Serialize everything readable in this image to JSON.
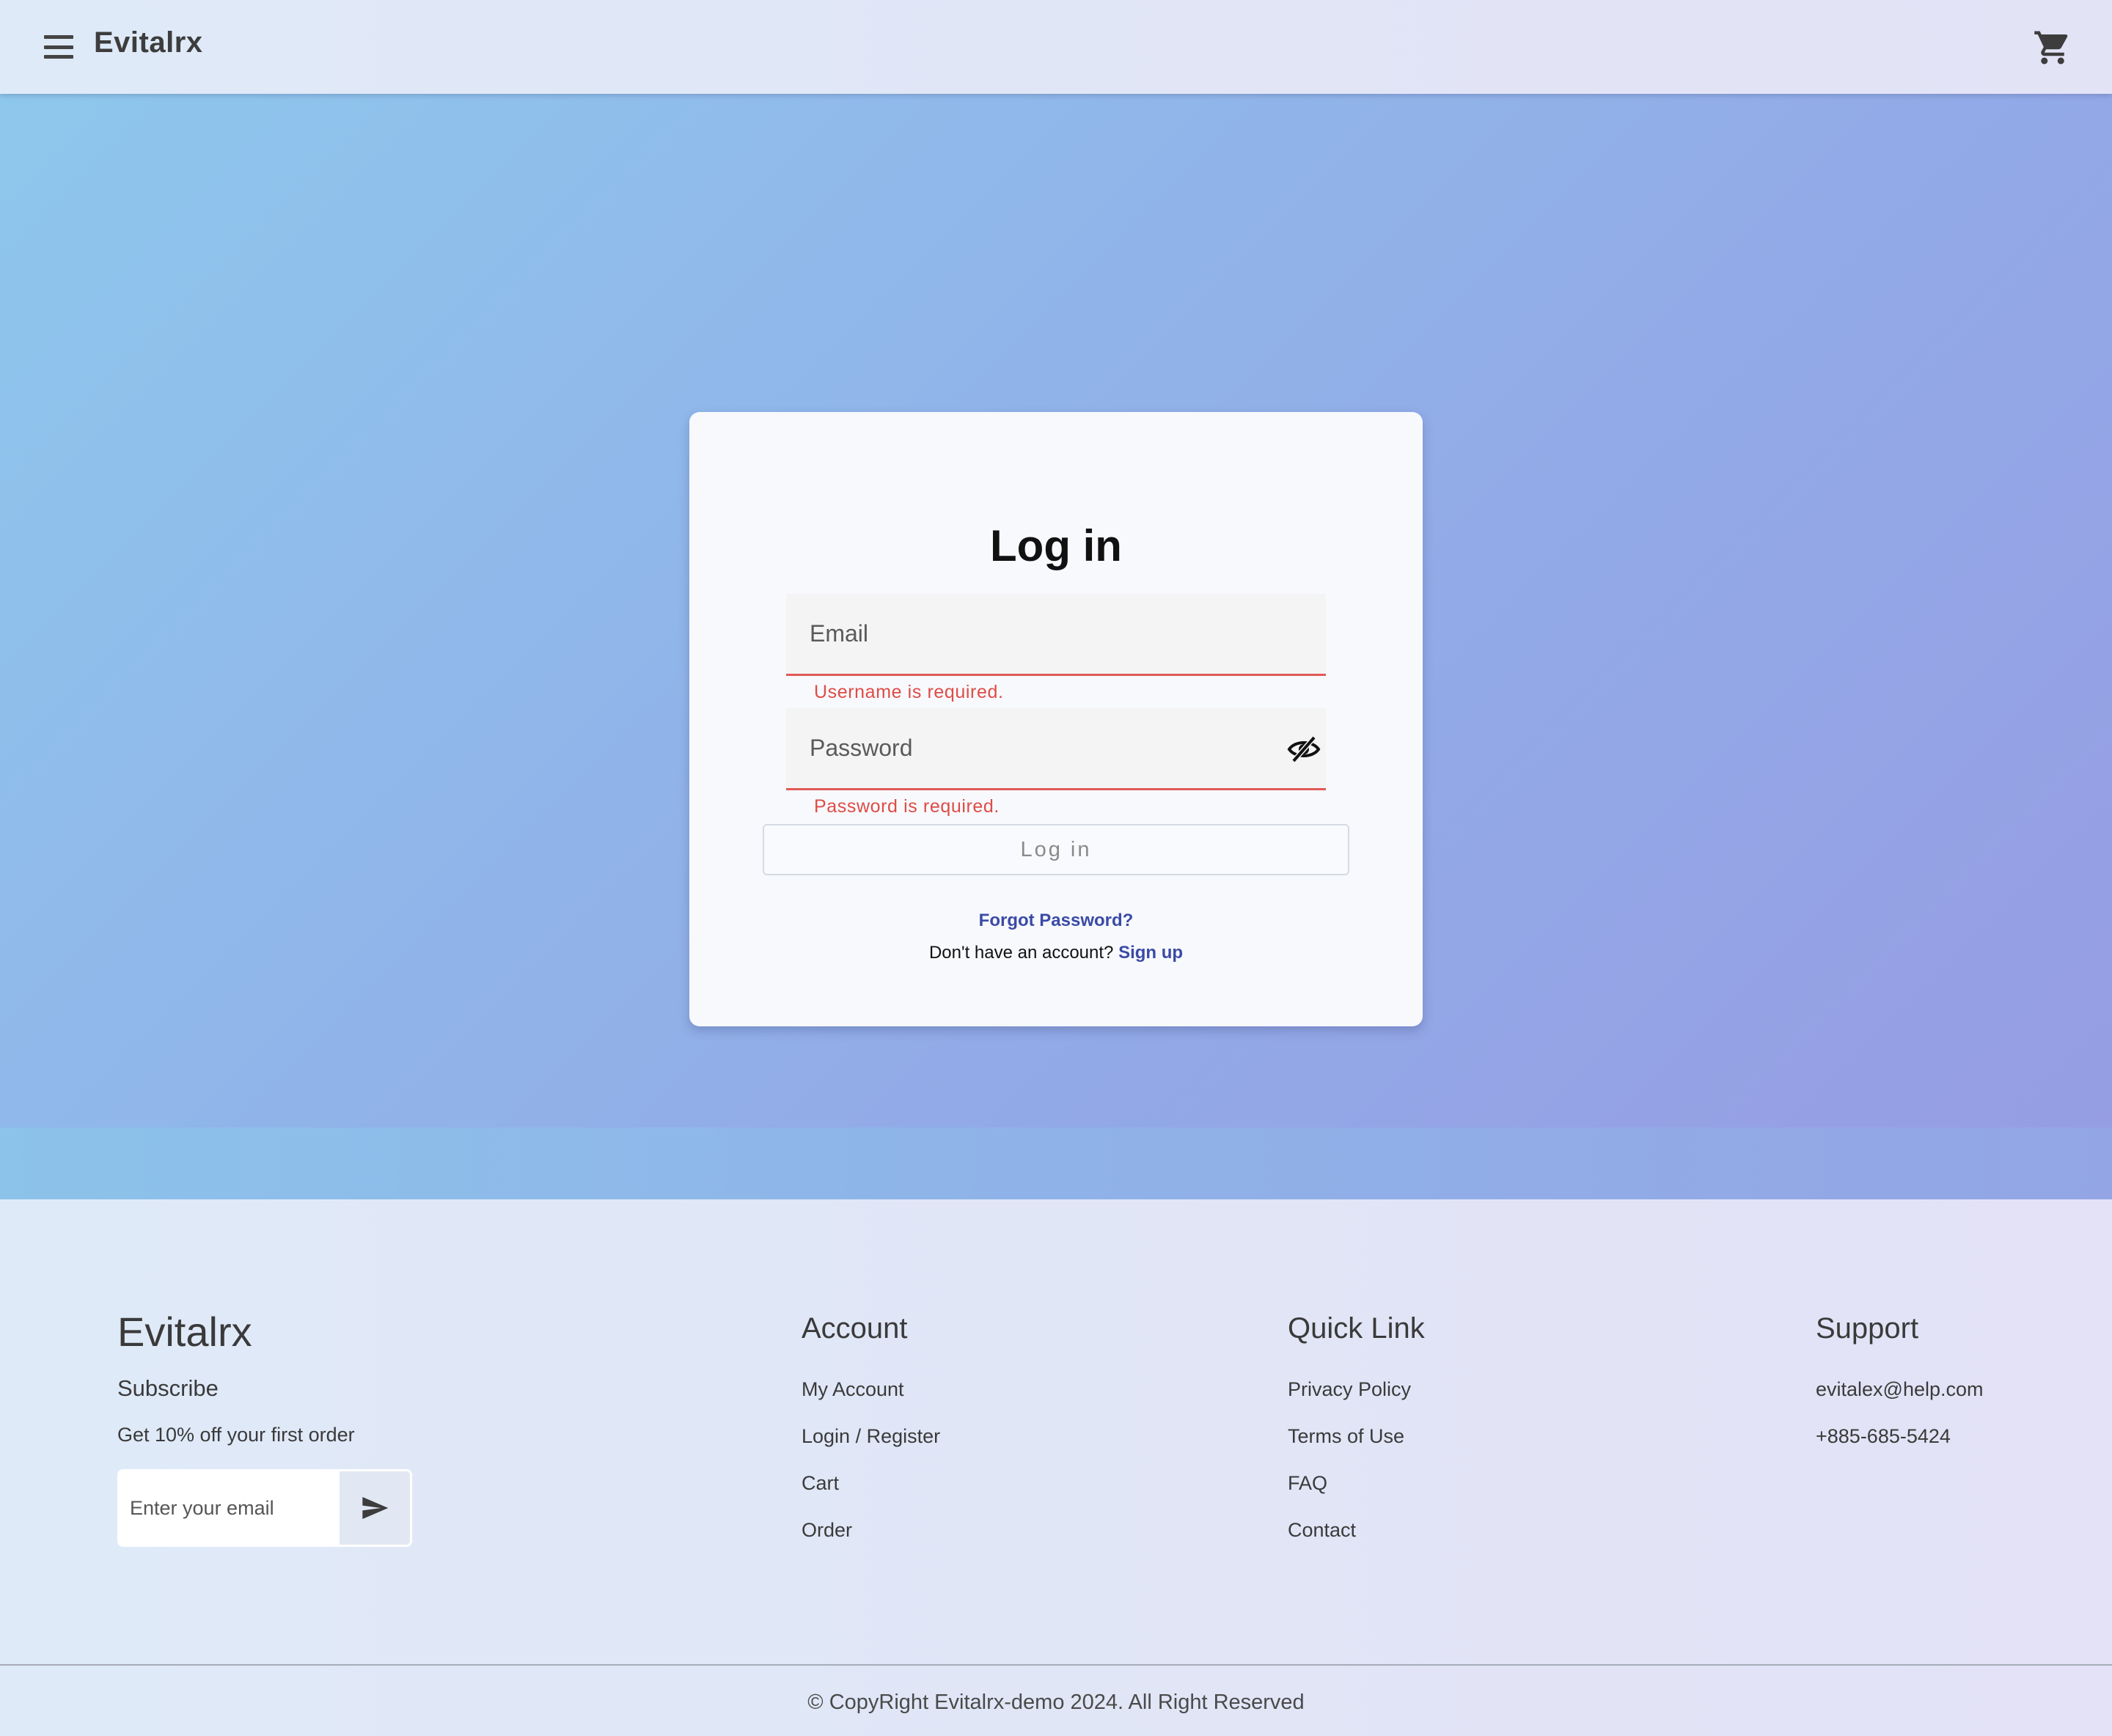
{
  "header": {
    "brand": "Evitalrx",
    "menu_icon": "hamburger-menu-icon",
    "cart_icon": "shopping-cart-icon"
  },
  "login": {
    "title": "Log in",
    "email_placeholder": "Email",
    "email_error": "Username is required.",
    "password_placeholder": "Password",
    "password_error": "Password is required.",
    "visibility_icon": "eye-slash-icon",
    "submit_label": "Log in",
    "forgot_label": "Forgot Password?",
    "signup_prompt": "Don't have an account?",
    "signup_label": "Sign up"
  },
  "footer": {
    "brand": "Evitalrx",
    "subscribe_title": "Subscribe",
    "subscribe_offer": "Get 10% off your first order",
    "email_placeholder": "Enter your email",
    "send_icon": "send-icon",
    "account": {
      "title": "Account",
      "items": [
        "My Account",
        "Login / Register",
        "Cart",
        "Order"
      ]
    },
    "quick_link": {
      "title": "Quick Link",
      "items": [
        "Privacy Policy",
        "Terms of Use",
        "FAQ",
        "Contact"
      ]
    },
    "support": {
      "title": "Support",
      "email": "evitalex@help.com",
      "phone": "+885-685-5424"
    },
    "copyright": "© CopyRight Evitalrx-demo 2024. All Right Reserved"
  },
  "colors": {
    "error": "#e04b45",
    "link": "#3a4aa5",
    "hero_start": "#8ec7ec",
    "hero_end": "#969de3"
  }
}
